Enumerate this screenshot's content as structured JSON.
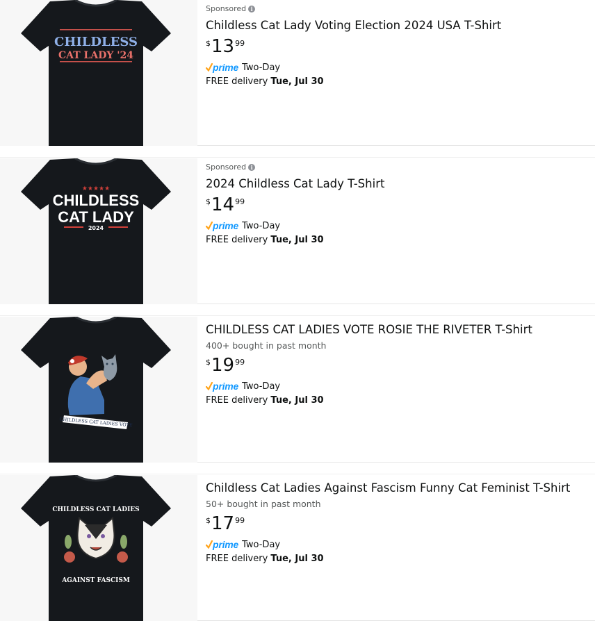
{
  "products": [
    {
      "sponsored": "Sponsored",
      "title": "Childless Cat Lady Voting Election 2024 USA T-Shirt",
      "bought": "",
      "price": {
        "symbol": "$",
        "whole": "13",
        "fraction": "99"
      },
      "prime": {
        "logo": "prime",
        "speed": "Two-Day"
      },
      "delivery": {
        "prefix": "FREE delivery",
        "date": "Tue, Jul 30"
      },
      "image": {
        "text": [
          "CHILDLESS",
          "CAT LADY '24"
        ]
      }
    },
    {
      "sponsored": "Sponsored",
      "title": "2024 Childless Cat Lady T-Shirt",
      "bought": "",
      "price": {
        "symbol": "$",
        "whole": "14",
        "fraction": "99"
      },
      "prime": {
        "logo": "prime",
        "speed": "Two-Day"
      },
      "delivery": {
        "prefix": "FREE delivery",
        "date": "Tue, Jul 30"
      },
      "image": {
        "text": [
          "★★★★★",
          "CHILDLESS",
          "CAT LADY",
          "2024"
        ]
      }
    },
    {
      "sponsored": "",
      "title": "CHILDLESS CAT LADIES VOTE ROSIE THE RIVETER T-Shirt",
      "bought": "400+ bought in past month",
      "price": {
        "symbol": "$",
        "whole": "19",
        "fraction": "99"
      },
      "prime": {
        "logo": "prime",
        "speed": "Two-Day"
      },
      "delivery": {
        "prefix": "FREE delivery",
        "date": "Tue, Jul 30"
      },
      "image": {
        "text": [
          "CHILDLESS CAT LADIES VOTE"
        ]
      }
    },
    {
      "sponsored": "",
      "title": "Childless Cat Ladies Against Fascism Funny Cat Feminist T-Shirt",
      "bought": "50+ bought in past month",
      "price": {
        "symbol": "$",
        "whole": "17",
        "fraction": "99"
      },
      "prime": {
        "logo": "prime",
        "speed": "Two-Day"
      },
      "delivery": {
        "prefix": "FREE delivery",
        "date": "Tue, Jul 30"
      },
      "image": {
        "text": [
          "CHILDLESS CAT LADIES",
          "AGAINST FASCISM"
        ]
      }
    }
  ],
  "colors": {
    "prime_blue": "#1399ff",
    "check_orange": "#ffa41c",
    "shirt": "#15181c",
    "text_secondary": "#565959"
  }
}
